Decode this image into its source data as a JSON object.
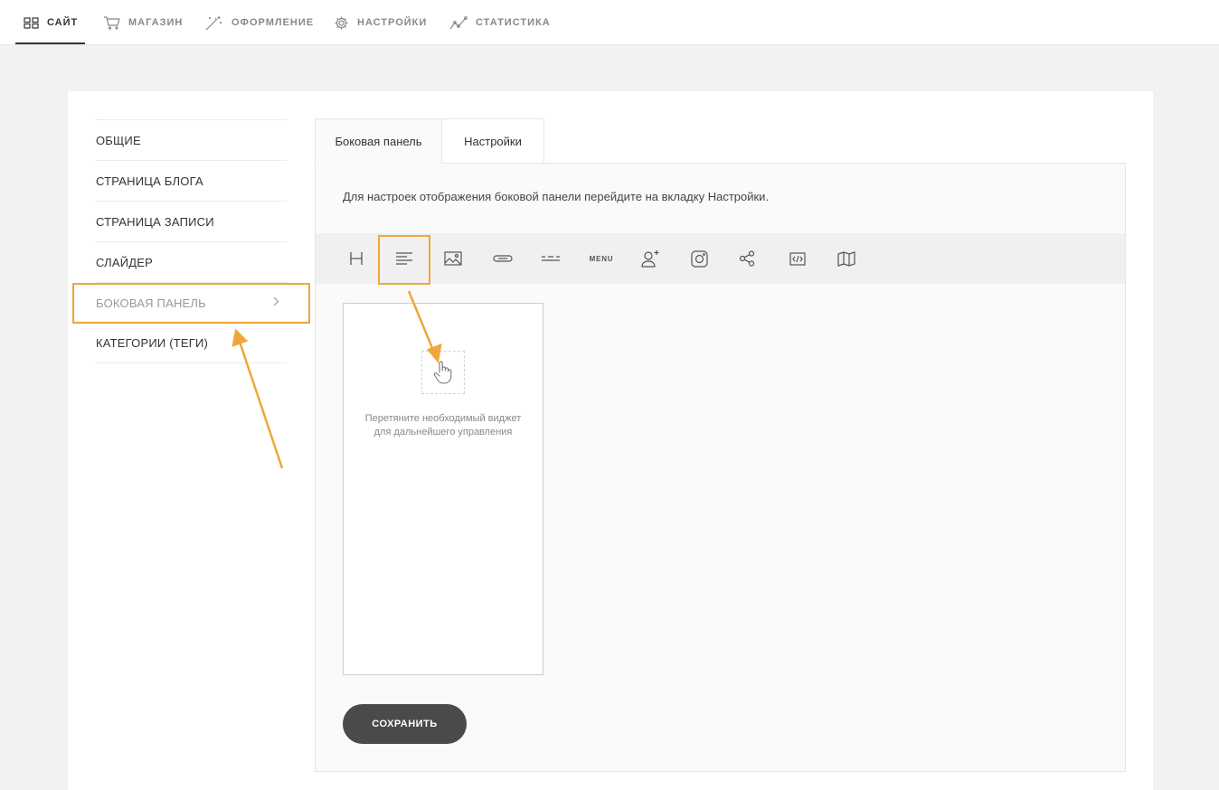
{
  "topnav": {
    "items": [
      {
        "label": "САЙТ",
        "icon": "grid-icon",
        "active": true
      },
      {
        "label": "МАГАЗИН",
        "icon": "cart-icon"
      },
      {
        "label": "ОФОРМЛЕНИЕ",
        "icon": "magic-wand-icon"
      },
      {
        "label": "НАСТРОЙКИ",
        "icon": "gear-icon"
      },
      {
        "label": "СТАТИСТИКА",
        "icon": "chart-line-icon"
      }
    ]
  },
  "sidebar": {
    "items": [
      {
        "label": "ОБЩИЕ"
      },
      {
        "label": "СТРАНИЦА БЛОГА"
      },
      {
        "label": "СТРАНИЦА ЗАПИСИ"
      },
      {
        "label": "СЛАЙДЕР"
      },
      {
        "label": "БОКОВАЯ ПАНЕЛЬ",
        "active": true
      },
      {
        "label": "КАТЕГОРИИ (ТЕГИ)"
      }
    ]
  },
  "tabs": [
    {
      "label": "Боковая панель",
      "active": true
    },
    {
      "label": "Настройки"
    }
  ],
  "info_text": "Для настроек отображения боковой панели перейдите на вкладку Настройки.",
  "toolbar": {
    "widgets": [
      "heading-icon",
      "text-align-icon",
      "image-icon",
      "button-icon",
      "divider-icon",
      "menu-text",
      "user-add-icon",
      "instagram-icon",
      "share-icon",
      "code-icon",
      "map-icon"
    ],
    "menu_label": "MENU"
  },
  "dropzone": {
    "hint_line1": "Перетяните необходимый виджет",
    "hint_line2": "для дальнейшего управления"
  },
  "save_label": "СОХРАНИТЬ",
  "colors": {
    "highlight": "#f0a63a",
    "button": "#4a4a4a"
  }
}
